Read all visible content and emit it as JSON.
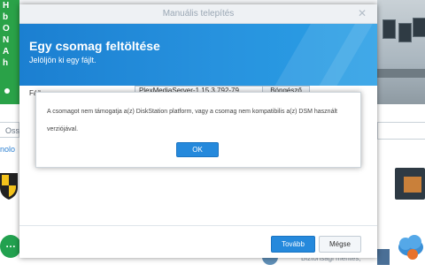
{
  "background": {
    "left_banner_lines": [
      "H",
      "b",
      "O",
      "N",
      "A",
      "h"
    ],
    "search_placeholder": "Ossz",
    "category_label": "nolo",
    "security_text": "Biztonsági mentés,"
  },
  "dialog": {
    "title": "Manuális telepítés",
    "header_title": "Egy csomag feltöltése",
    "header_subtitle": "Jelöljön ki egy fájlt.",
    "file_label": "Fájl",
    "file_value": "PlexMediaServer-1.15.3.792-79",
    "browse_label": "Böngésző",
    "next_label": "Tovább",
    "cancel_label": "Mégse"
  },
  "alert": {
    "message": "A csomagot nem támogatja a(z) DiskStation platform, vagy a csomag nem kompatibilis a(z) DSM használt verziójával.",
    "ok_label": "OK"
  },
  "colors": {
    "accent": "#2589dc",
    "banner_blue": "#1b7fd1",
    "green": "#2aa248"
  }
}
